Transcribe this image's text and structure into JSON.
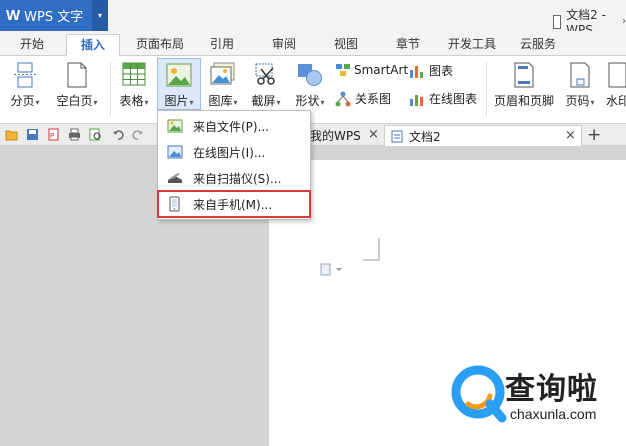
{
  "titlebar": {
    "app_logo": "W",
    "app_name": "WPS 文字",
    "doc_title": "文档2 - WPS",
    "menu_arrow": "▾",
    "title_arrow": "›"
  },
  "tabs": [
    {
      "label": "开始"
    },
    {
      "label": "插入"
    },
    {
      "label": "页面布局"
    },
    {
      "label": "引用"
    },
    {
      "label": "审阅"
    },
    {
      "label": "视图"
    },
    {
      "label": "章节"
    },
    {
      "label": "开发工具"
    },
    {
      "label": "云服务"
    }
  ],
  "ribbon": {
    "page_break": "分页",
    "blank_page": "空白页",
    "table": "表格",
    "picture": "图片",
    "gallery": "图库",
    "screenshot": "截屏",
    "shapes": "形状",
    "smartart": "SmartArt",
    "chart": "图表",
    "relation_chart": "关系图",
    "online_chart": "在线图表",
    "header_footer": "页眉和页脚",
    "page_number": "页码",
    "watermark": "水印",
    "caret": "▾"
  },
  "doc_tabs": {
    "my_wps": "我的WPS",
    "doc2": "文档2",
    "close": "×",
    "add": "+"
  },
  "picture_menu": {
    "items": [
      {
        "label": "来自文件(P)..."
      },
      {
        "label": "在线图片(I)..."
      },
      {
        "label": "来自扫描仪(S)..."
      },
      {
        "label": "来自手机(M)..."
      }
    ]
  },
  "watermark": {
    "brand": "查询啦",
    "url": "chaxunla.com"
  },
  "colors": {
    "accent": "#2f6ec2",
    "highlight": "#d9393a"
  }
}
